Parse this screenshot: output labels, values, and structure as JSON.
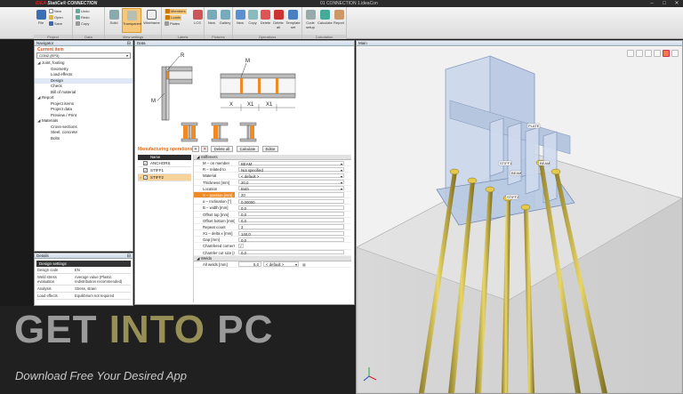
{
  "app": {
    "brand_prefix": "IDEA",
    "brand_suffix": "StatiCa®",
    "module": "CONNECTION",
    "window_title": "01 CONNECTION 1.ideaCon",
    "controls": [
      "–",
      "□",
      "✕"
    ]
  },
  "ribbon": {
    "groups": [
      {
        "label": "Project",
        "buttons": [
          "File"
        ],
        "small": [
          "New",
          "Open",
          "Save"
        ]
      },
      {
        "label": "Data",
        "small": [
          "Undo",
          "Redo",
          "Copy"
        ]
      },
      {
        "label": "View settings",
        "buttons": [
          "Solid",
          "Transparent",
          "Wireframe"
        ]
      },
      {
        "label": "Labels",
        "small": [
          "Members",
          "Loads",
          "Plates"
        ],
        "buttons": [
          "LCS"
        ]
      },
      {
        "label": "Pictures",
        "buttons": [
          "New",
          "Gallery"
        ]
      },
      {
        "label": "Operations",
        "buttons": [
          "New",
          "Copy",
          "Delete",
          "Delete all",
          "Template set"
        ]
      },
      {
        "label": "Calculation",
        "buttons": [
          "Code setup",
          "Calculate",
          "Report"
        ]
      }
    ]
  },
  "navigator": {
    "title": "Navigator",
    "current_label": "Current item",
    "selector_value": "CON2 (EP3)",
    "tree": [
      {
        "label": "Joint, footing",
        "level": 0,
        "caret": "◢"
      },
      {
        "label": "Geometry",
        "level": 1
      },
      {
        "label": "Load effects",
        "level": 1
      },
      {
        "label": "Design",
        "level": 1,
        "selected": true
      },
      {
        "label": "Check",
        "level": 1
      },
      {
        "label": "Bill of material",
        "level": 1
      },
      {
        "label": "Report",
        "level": 0,
        "caret": "◢"
      },
      {
        "label": "Project items",
        "level": 1
      },
      {
        "label": "Project data",
        "level": 1
      },
      {
        "label": "Preview / Print",
        "level": 1
      },
      {
        "label": "Materials",
        "level": 0,
        "caret": "◢"
      },
      {
        "label": "Cross-sections",
        "level": 1
      },
      {
        "label": "Steel, concrete",
        "level": 1
      },
      {
        "label": "Bolts",
        "level": 1
      }
    ]
  },
  "details": {
    "title": "Details",
    "header": "Design settings",
    "rows": [
      {
        "k": "Design code",
        "v": "EN"
      },
      {
        "k": "Weld stress evaluation",
        "v": "Average value (Plastic redistribution recommended)"
      },
      {
        "k": "Analysis",
        "v": "Stress, strain"
      },
      {
        "k": "Load effects",
        "v": "Equilibrium not required"
      }
    ]
  },
  "data_panel": {
    "tab": "Data",
    "sketch_labels": [
      "R",
      "M",
      "M",
      "X",
      "X1",
      "X1"
    ],
    "mfg_title": "Manufacturing operations",
    "toolbar": [
      "Delete all",
      "Calculate",
      "Editor"
    ],
    "ops_header": "Name",
    "ops": [
      {
        "name": "ANCHORS",
        "checked": true,
        "selected": false
      },
      {
        "name": "STIFF1",
        "checked": true,
        "selected": false
      },
      {
        "name": "STIFF2",
        "checked": true,
        "selected": true
      }
    ],
    "props_section": "Stiffeners",
    "props": [
      {
        "k": "M – on member",
        "v": "BEAM",
        "drop": true
      },
      {
        "k": "R – related to",
        "v": "Not specified",
        "drop": true
      },
      {
        "k": "Material",
        "v": "< default >",
        "drop": true
      },
      {
        "k": "Thickness [mm]",
        "v": "20,0",
        "drop": true
      },
      {
        "k": "Location",
        "v": "Both",
        "drop": true
      },
      {
        "k": "X – position [mm]",
        "v": "20",
        "hl": true
      },
      {
        "k": "α – Inclination [°]",
        "v": "0,00000"
      },
      {
        "k": "B – width [mm]",
        "v": "0,0"
      },
      {
        "k": "Offset top [mm]",
        "v": "0,0"
      },
      {
        "k": "Offset bottom [mm]",
        "v": "0,0"
      },
      {
        "k": "Repeat count",
        "v": "3"
      },
      {
        "k": "X1 – delta x [mm]",
        "v": "140,0"
      },
      {
        "k": "Gap [mm]",
        "v": "0,0"
      },
      {
        "k": "Chamfered corners",
        "v": "✓",
        "check": true
      },
      {
        "k": "Chamfer cut size [mm]",
        "v": "0,0"
      }
    ],
    "welds_section": "Welds",
    "welds_row": {
      "k": "All welds [mm]",
      "v": "5,0",
      "type": "< default >"
    }
  },
  "view_panel": {
    "tab": "Main",
    "labels": [
      "PLATE",
      "STIFF1",
      "BEAM",
      "BEAM",
      "STIFF2"
    ]
  },
  "watermark": {
    "title_a": "GET ",
    "title_b": "INTO",
    "title_c": " PC",
    "subtitle": "Download Free Your Desired App"
  }
}
